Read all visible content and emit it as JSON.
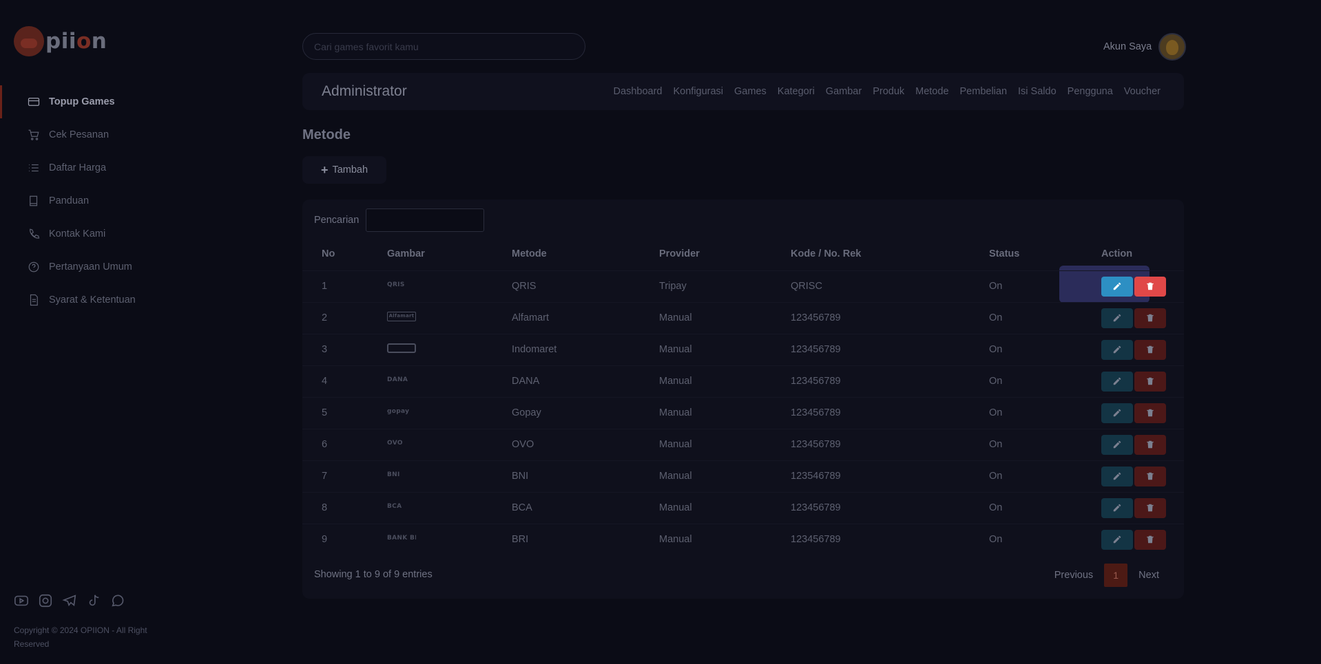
{
  "brand": {
    "name_prefix": "pii",
    "name_accent": "o",
    "name_suffix": "n"
  },
  "sidebar": {
    "items": [
      {
        "label": "Topup Games",
        "icon": "credit-card-icon",
        "active": true
      },
      {
        "label": "Cek Pesanan",
        "icon": "cart-icon"
      },
      {
        "label": "Daftar Harga",
        "icon": "list-icon"
      },
      {
        "label": "Panduan",
        "icon": "book-icon"
      },
      {
        "label": "Kontak Kami",
        "icon": "phone-icon"
      },
      {
        "label": "Pertanyaan Umum",
        "icon": "question-icon"
      },
      {
        "label": "Syarat & Ketentuan",
        "icon": "document-icon"
      }
    ],
    "social_icons": [
      "youtube-icon",
      "instagram-icon",
      "telegram-icon",
      "tiktok-icon",
      "whatsapp-icon"
    ],
    "copyright": "Copyright © 2024 OPIION - All Right Reserved"
  },
  "topbar": {
    "search_placeholder": "Cari games favorit kamu",
    "account_label": "Akun Saya"
  },
  "admin": {
    "title": "Administrator",
    "nav": [
      "Dashboard",
      "Konfigurasi",
      "Games",
      "Kategori",
      "Gambar",
      "Produk",
      "Metode",
      "Pembelian",
      "Isi Saldo",
      "Pengguna",
      "Voucher"
    ]
  },
  "page": {
    "heading": "Metode",
    "add_label": "Tambah"
  },
  "table": {
    "search_label": "Pencarian",
    "columns": [
      "No",
      "Gambar",
      "Metode",
      "Provider",
      "Kode / No. Rek",
      "Status",
      "Action"
    ],
    "rows": [
      {
        "no": "1",
        "logo": "QRIS",
        "metode": "QRIS",
        "provider": "Tripay",
        "kode": "QRISC",
        "status": "On"
      },
      {
        "no": "2",
        "logo": "Alfamart",
        "metode": "Alfamart",
        "provider": "Manual",
        "kode": "123456789",
        "status": "On"
      },
      {
        "no": "3",
        "logo": "",
        "metode": "Indomaret",
        "provider": "Manual",
        "kode": "123456789",
        "status": "On"
      },
      {
        "no": "4",
        "logo": "DANA",
        "metode": "DANA",
        "provider": "Manual",
        "kode": "123456789",
        "status": "On"
      },
      {
        "no": "5",
        "logo": "gopay",
        "metode": "Gopay",
        "provider": "Manual",
        "kode": "123456789",
        "status": "On"
      },
      {
        "no": "6",
        "logo": "OVO",
        "metode": "OVO",
        "provider": "Manual",
        "kode": "123456789",
        "status": "On"
      },
      {
        "no": "7",
        "logo": "BNI",
        "metode": "BNI",
        "provider": "Manual",
        "kode": "123546789",
        "status": "On"
      },
      {
        "no": "8",
        "logo": "BCA",
        "metode": "BCA",
        "provider": "Manual",
        "kode": "123456789",
        "status": "On"
      },
      {
        "no": "9",
        "logo": "BANK BRI",
        "metode": "BRI",
        "provider": "Manual",
        "kode": "123456789",
        "status": "On"
      }
    ],
    "info": "Showing 1 to 9 of 9 entries",
    "pager": {
      "previous": "Previous",
      "current": "1",
      "next": "Next"
    }
  },
  "colors": {
    "background": "#0b0c16",
    "accent": "#6b2219",
    "edit_active": "#2d8fc3",
    "delete_active": "#e04848"
  }
}
